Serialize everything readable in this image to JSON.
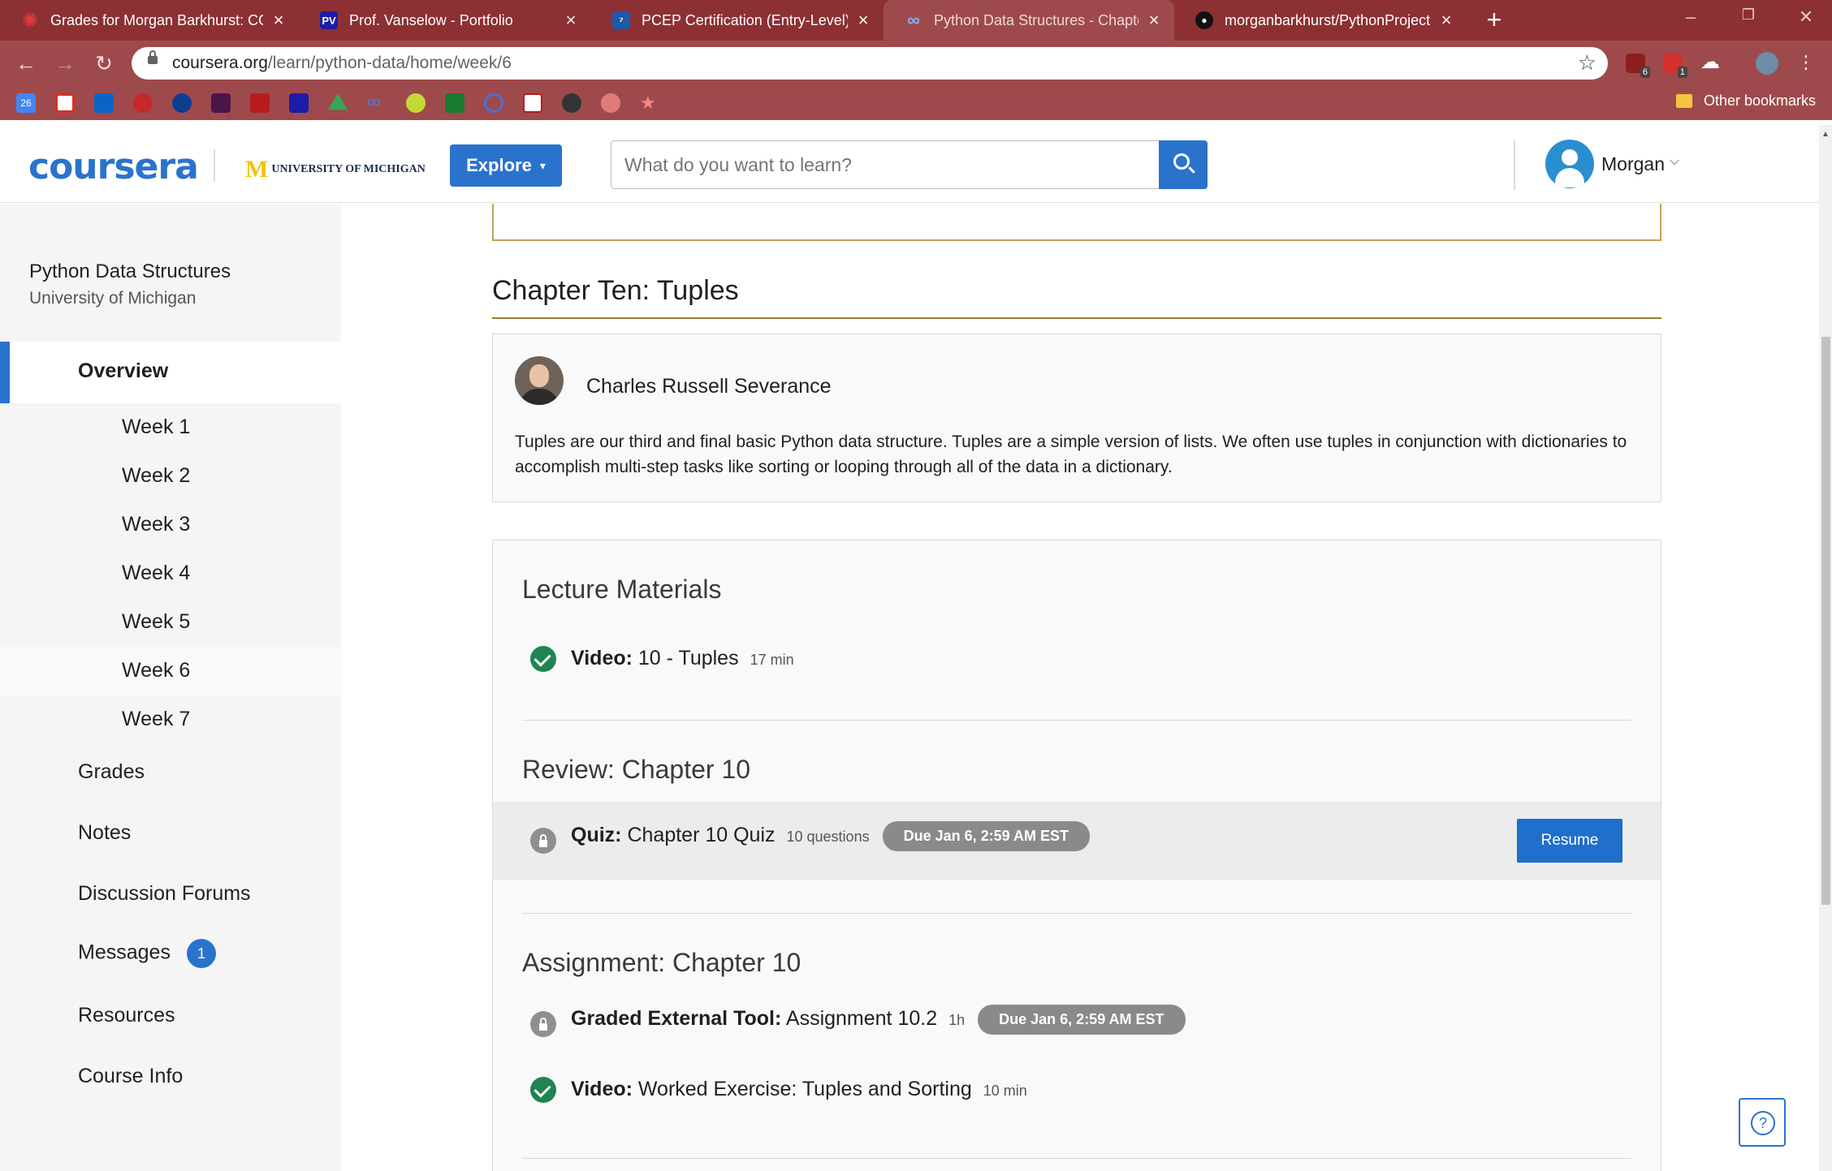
{
  "browser": {
    "tabs": [
      {
        "title": "Grades for Morgan Barkhurst: CO",
        "favicon": "asterisk-red-icon"
      },
      {
        "title": "Prof. Vanselow - Portfolio",
        "favicon": "pv-icon"
      },
      {
        "title": "PCEP Certification (Entry-Level) | I",
        "favicon": "python-institute-icon"
      },
      {
        "title": "Python Data Structures - Chapter",
        "favicon": "coursera-infinity-icon"
      },
      {
        "title": "morganbarkhurst/PythonProjectI",
        "favicon": "github-icon"
      }
    ],
    "active_tab": 3,
    "url_host": "coursera.org",
    "url_path": "/learn/python-data/home/week/6",
    "extensions": [
      {
        "name": "ublock-icon",
        "badge": "6"
      },
      {
        "name": "todo-icon",
        "badge": "1"
      },
      {
        "name": "cloud-icon",
        "badge": ""
      }
    ],
    "bookmark_calendar_day": "26",
    "other_bookmarks": "Other bookmarks",
    "colors": {
      "chrome_dark": "#8c3034",
      "chrome": "#9e4a4c"
    }
  },
  "header": {
    "logo": "coursera",
    "partner": "UNIVERSITY OF MICHIGAN",
    "explore_label": "Explore",
    "search_placeholder": "What do you want to learn?",
    "user_name": "Morgan"
  },
  "sidebar": {
    "course_name": "Python Data Structures",
    "university": "University of Michigan",
    "overview": "Overview",
    "weeks": [
      "Week 1",
      "Week 2",
      "Week 3",
      "Week 4",
      "Week 5",
      "Week 6",
      "Week 7"
    ],
    "selected_week": 5,
    "links": [
      "Grades",
      "Notes",
      "Discussion Forums",
      "Messages",
      "Resources",
      "Course Info"
    ],
    "messages_badge": "1"
  },
  "main": {
    "chapter_title": "Chapter Ten: Tuples",
    "instructor_name": "Charles Russell Severance",
    "description": "Tuples are our third and final basic Python data structure. Tuples are a simple version of lists. We often use tuples in conjunction with dictionaries to accomplish multi-step tasks like sorting or looping through all of the data in a dictionary.",
    "sections": {
      "lecture": {
        "title": "Lecture Materials",
        "items": [
          {
            "type": "Video:",
            "name": "10 - Tuples",
            "meta": "17 min",
            "status": "completed"
          }
        ]
      },
      "review": {
        "title": "Review: Chapter 10",
        "items": [
          {
            "type": "Quiz:",
            "name": "Chapter 10 Quiz",
            "meta": "10 questions",
            "due": "Due Jan 6, 2:59 AM EST",
            "action": "Resume",
            "status": "locked"
          }
        ]
      },
      "assignment": {
        "title": "Assignment: Chapter 10",
        "items": [
          {
            "type": "Graded External Tool:",
            "name": "Assignment 10.2",
            "meta": "1h",
            "due": "Due Jan 6, 2:59 AM EST",
            "status": "locked"
          },
          {
            "type": "Video:",
            "name": "Worked Exercise: Tuples and Sorting",
            "meta": "10 min",
            "status": "completed"
          }
        ]
      }
    },
    "help_label": "?"
  }
}
